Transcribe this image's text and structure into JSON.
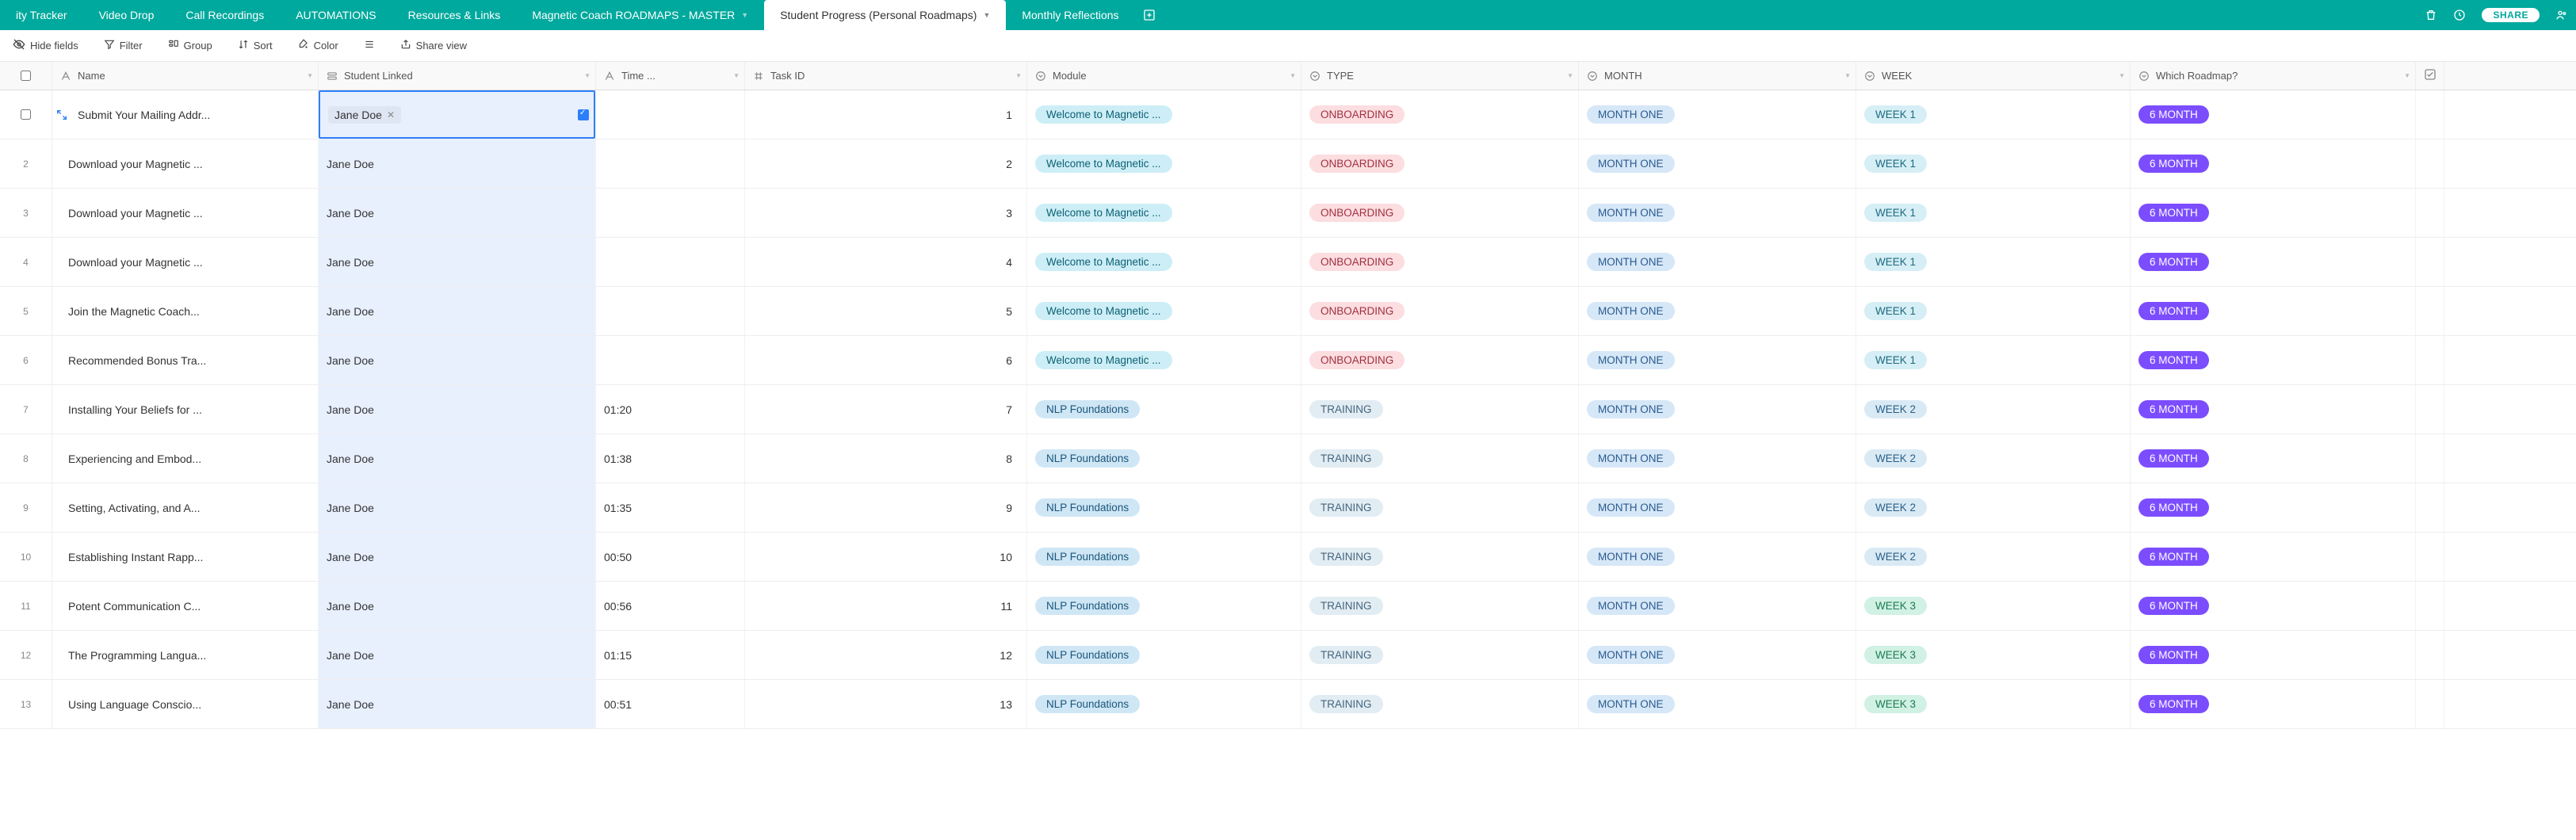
{
  "tabs": [
    {
      "label": "ity Tracker",
      "active": false,
      "dd": false
    },
    {
      "label": "Video Drop",
      "active": false,
      "dd": false
    },
    {
      "label": "Call Recordings",
      "active": false,
      "dd": false
    },
    {
      "label": "AUTOMATIONS",
      "active": false,
      "dd": false
    },
    {
      "label": "Resources & Links",
      "active": false,
      "dd": false
    },
    {
      "label": "Magnetic Coach ROADMAPS - MASTER",
      "active": false,
      "dd": true
    },
    {
      "label": "Student Progress (Personal Roadmaps)",
      "active": true,
      "dd": true
    },
    {
      "label": "Monthly Reflections",
      "active": false,
      "dd": false
    }
  ],
  "topControls": {
    "share": "SHARE"
  },
  "toolbar": {
    "hideFields": "Hide fields",
    "filter": "Filter",
    "group": "Group",
    "sort": "Sort",
    "color": "Color",
    "share": "Share view"
  },
  "columns": {
    "name": "Name",
    "student": "Student Linked",
    "time": "Time ...",
    "task": "Task ID",
    "module": "Module",
    "type": "TYPE",
    "month": "MONTH",
    "week": "WEEK",
    "roadmap": "Which Roadmap?"
  },
  "rows": [
    {
      "n": "",
      "name": "Submit Your Mailing Addr...",
      "student": "Jane Doe",
      "time": "",
      "task": "1",
      "module": "Welcome to Magnetic ...",
      "moduleClass": "module-welcome",
      "type": "ONBOARDING",
      "typeClass": "type-onboard",
      "month": "MONTH ONE",
      "week": "WEEK 1",
      "weekClass": "week-1",
      "roadmap": "6 MONTH",
      "first": true
    },
    {
      "n": "2",
      "name": "Download your Magnetic ...",
      "student": "Jane Doe",
      "time": "",
      "task": "2",
      "module": "Welcome to Magnetic ...",
      "moduleClass": "module-welcome",
      "type": "ONBOARDING",
      "typeClass": "type-onboard",
      "month": "MONTH ONE",
      "week": "WEEK 1",
      "weekClass": "week-1",
      "roadmap": "6 MONTH"
    },
    {
      "n": "3",
      "name": "Download your Magnetic ...",
      "student": "Jane Doe",
      "time": "",
      "task": "3",
      "module": "Welcome to Magnetic ...",
      "moduleClass": "module-welcome",
      "type": "ONBOARDING",
      "typeClass": "type-onboard",
      "month": "MONTH ONE",
      "week": "WEEK 1",
      "weekClass": "week-1",
      "roadmap": "6 MONTH"
    },
    {
      "n": "4",
      "name": "Download your Magnetic ...",
      "student": "Jane Doe",
      "time": "",
      "task": "4",
      "module": "Welcome to Magnetic ...",
      "moduleClass": "module-welcome",
      "type": "ONBOARDING",
      "typeClass": "type-onboard",
      "month": "MONTH ONE",
      "week": "WEEK 1",
      "weekClass": "week-1",
      "roadmap": "6 MONTH"
    },
    {
      "n": "5",
      "name": "Join the Magnetic Coach...",
      "student": "Jane Doe",
      "time": "",
      "task": "5",
      "module": "Welcome to Magnetic ...",
      "moduleClass": "module-welcome",
      "type": "ONBOARDING",
      "typeClass": "type-onboard",
      "month": "MONTH ONE",
      "week": "WEEK 1",
      "weekClass": "week-1",
      "roadmap": "6 MONTH"
    },
    {
      "n": "6",
      "name": "Recommended Bonus Tra...",
      "student": "Jane Doe",
      "time": "",
      "task": "6",
      "module": "Welcome to Magnetic ...",
      "moduleClass": "module-welcome",
      "type": "ONBOARDING",
      "typeClass": "type-onboard",
      "month": "MONTH ONE",
      "week": "WEEK 1",
      "weekClass": "week-1",
      "roadmap": "6 MONTH"
    },
    {
      "n": "7",
      "name": "Installing Your Beliefs for ...",
      "student": "Jane Doe",
      "time": "01:20",
      "task": "7",
      "module": "NLP Foundations",
      "moduleClass": "module-nlp",
      "type": "TRAINING",
      "typeClass": "type-training",
      "month": "MONTH ONE",
      "week": "WEEK 2",
      "weekClass": "week-2",
      "roadmap": "6 MONTH"
    },
    {
      "n": "8",
      "name": "Experiencing and Embod...",
      "student": "Jane Doe",
      "time": "01:38",
      "task": "8",
      "module": "NLP Foundations",
      "moduleClass": "module-nlp",
      "type": "TRAINING",
      "typeClass": "type-training",
      "month": "MONTH ONE",
      "week": "WEEK 2",
      "weekClass": "week-2",
      "roadmap": "6 MONTH"
    },
    {
      "n": "9",
      "name": "Setting, Activating, and A...",
      "student": "Jane Doe",
      "time": "01:35",
      "task": "9",
      "module": "NLP Foundations",
      "moduleClass": "module-nlp",
      "type": "TRAINING",
      "typeClass": "type-training",
      "month": "MONTH ONE",
      "week": "WEEK 2",
      "weekClass": "week-2",
      "roadmap": "6 MONTH"
    },
    {
      "n": "10",
      "name": "Establishing Instant Rapp...",
      "student": "Jane Doe",
      "time": "00:50",
      "task": "10",
      "module": "NLP Foundations",
      "moduleClass": "module-nlp",
      "type": "TRAINING",
      "typeClass": "type-training",
      "month": "MONTH ONE",
      "week": "WEEK 2",
      "weekClass": "week-2",
      "roadmap": "6 MONTH"
    },
    {
      "n": "11",
      "name": "Potent Communication C...",
      "student": "Jane Doe",
      "time": "00:56",
      "task": "11",
      "module": "NLP Foundations",
      "moduleClass": "module-nlp",
      "type": "TRAINING",
      "typeClass": "type-training",
      "month": "MONTH ONE",
      "week": "WEEK 3",
      "weekClass": "week-3",
      "roadmap": "6 MONTH"
    },
    {
      "n": "12",
      "name": "The Programming Langua...",
      "student": "Jane Doe",
      "time": "01:15",
      "task": "12",
      "module": "NLP Foundations",
      "moduleClass": "module-nlp",
      "type": "TRAINING",
      "typeClass": "type-training",
      "month": "MONTH ONE",
      "week": "WEEK 3",
      "weekClass": "week-3",
      "roadmap": "6 MONTH"
    },
    {
      "n": "13",
      "name": "Using Language Conscio...",
      "student": "Jane Doe",
      "time": "00:51",
      "task": "13",
      "module": "NLP Foundations",
      "moduleClass": "module-nlp",
      "type": "TRAINING",
      "typeClass": "type-training",
      "month": "MONTH ONE",
      "week": "WEEK 3",
      "weekClass": "week-3",
      "roadmap": "6 MONTH"
    }
  ]
}
